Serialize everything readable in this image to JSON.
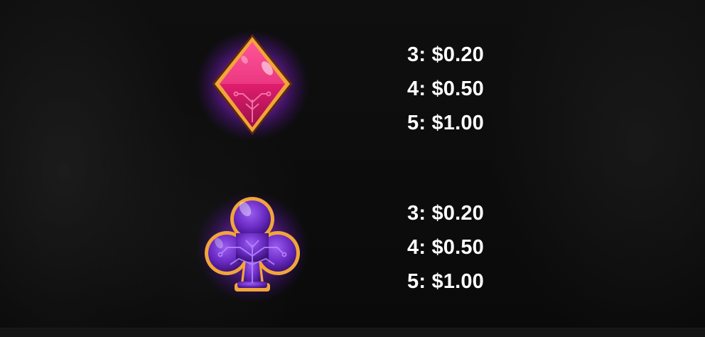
{
  "paytable": {
    "symbols": [
      {
        "icon": "diamond-suit-icon",
        "color": "#e0206c",
        "payouts": [
          {
            "text": "3: $0.20"
          },
          {
            "text": "4: $0.50"
          },
          {
            "text": "5: $1.00"
          }
        ]
      },
      {
        "icon": "club-suit-icon",
        "color": "#6a2bc4",
        "payouts": [
          {
            "text": "3: $0.20"
          },
          {
            "text": "4: $0.50"
          },
          {
            "text": "5: $1.00"
          }
        ]
      }
    ]
  },
  "colors": {
    "background": "#0b0b0b",
    "glow": "#b12cff",
    "border_gold": "#f2a53a",
    "text": "#ffffff"
  }
}
